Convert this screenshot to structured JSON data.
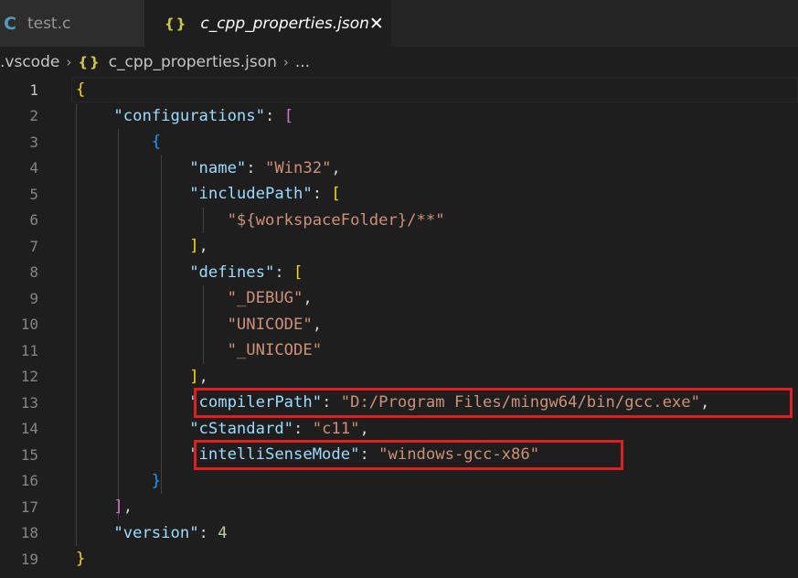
{
  "tabs": [
    {
      "icon": "C",
      "label": "test.c",
      "active": false
    },
    {
      "icon": "{}",
      "label": "c_cpp_properties.json",
      "active": true,
      "close": "✕"
    }
  ],
  "breadcrumb": {
    "folder": ".vscode",
    "file_icon": "{}",
    "file": "c_cpp_properties.json",
    "more": "..."
  },
  "editor": {
    "line_numbers": [
      "1",
      "2",
      "3",
      "4",
      "5",
      "6",
      "7",
      "8",
      "9",
      "10",
      "11",
      "12",
      "13",
      "14",
      "15",
      "16",
      "17",
      "18",
      "19"
    ],
    "lines": {
      "l1_brace": "{",
      "l2_key": "\"configurations\"",
      "l2_colon": ": ",
      "l2_bracket": "[",
      "l3_brace": "{",
      "l4_key": "\"name\"",
      "l4_colon": ": ",
      "l4_val": "\"Win32\"",
      "l4_comma": ",",
      "l5_key": "\"includePath\"",
      "l5_colon": ": ",
      "l5_bracket": "[",
      "l6_val": "\"${workspaceFolder}/**\"",
      "l7_bracket": "]",
      "l7_comma": ",",
      "l8_key": "\"defines\"",
      "l8_colon": ": ",
      "l8_bracket": "[",
      "l9_val": "\"_DEBUG\"",
      "l9_comma": ",",
      "l10_val": "\"UNICODE\"",
      "l10_comma": ",",
      "l11_val": "\"_UNICODE\"",
      "l12_bracket": "]",
      "l12_comma": ",",
      "l13_key": "\"compilerPath\"",
      "l13_colon": ": ",
      "l13_val": "\"D:/Program Files/mingw64/bin/gcc.exe\"",
      "l13_comma": ",",
      "l14_key": "\"cStandard\"",
      "l14_colon": ": ",
      "l14_val": "\"c11\"",
      "l14_comma": ",",
      "l15_key": "\"intelliSenseMode\"",
      "l15_colon": ": ",
      "l15_val": "\"windows-gcc-x86\"",
      "l16_brace": "}",
      "l17_bracket": "]",
      "l17_comma": ",",
      "l18_key": "\"version\"",
      "l18_colon": ": ",
      "l18_val": "4",
      "l19_brace": "}"
    }
  },
  "colors": {
    "background": "#1e1e1e",
    "key": "#9cdcfe",
    "string": "#ce9178",
    "number": "#b5cea8",
    "bracket_level1": "#ffd700",
    "bracket_level2": "#da70d6",
    "bracket_level3": "#179fff",
    "highlight_box": "#e01e1e"
  }
}
